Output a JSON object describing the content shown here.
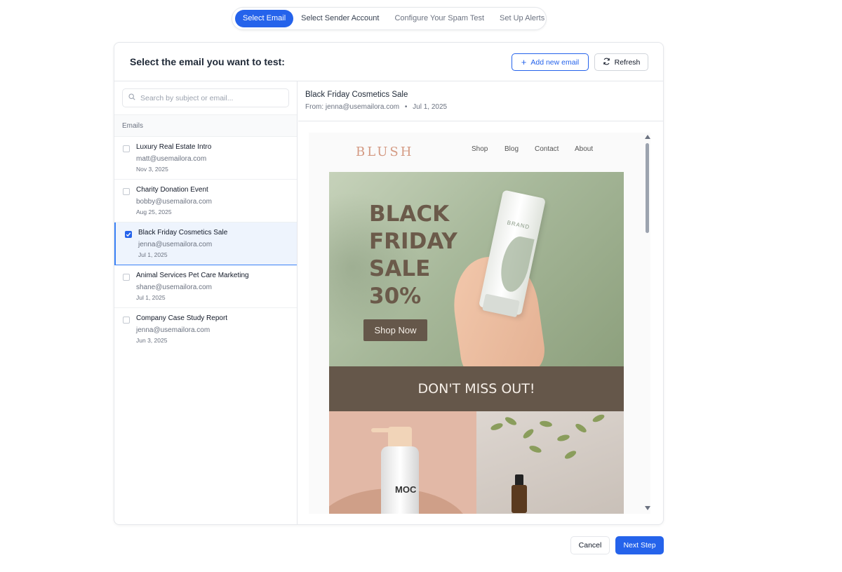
{
  "stepper": {
    "steps": [
      {
        "label": "Select Email",
        "active": true
      },
      {
        "label": "Select Sender Account",
        "active": false
      },
      {
        "label": "Configure Your Spam Test",
        "active": false
      },
      {
        "label": "Set Up Alerts",
        "active": false
      }
    ]
  },
  "header": {
    "title": "Select the email you want to test:",
    "add_label": "Add new email",
    "add_icon": "plus-icon",
    "refresh_label": "Refresh",
    "refresh_icon": "refresh-icon"
  },
  "search": {
    "placeholder": "Search by subject or email...",
    "icon": "search-icon"
  },
  "list": {
    "heading": "Emails",
    "items": [
      {
        "subject": "Luxury Real Estate Intro",
        "from": "matt@usemailora.com",
        "date": "Nov 3, 2025",
        "checked": false
      },
      {
        "subject": "Charity Donation Event",
        "from": "bobby@usemailora.com",
        "date": "Aug 25, 2025",
        "checked": false
      },
      {
        "subject": "Black Friday Cosmetics Sale",
        "from": "jenna@usemailora.com",
        "date": "Jul 1, 2025",
        "checked": true
      },
      {
        "subject": "Animal Services Pet Care Marketing",
        "from": "shane@usemailora.com",
        "date": "Jul 1, 2025",
        "checked": false
      },
      {
        "subject": "Company Case Study Report",
        "from": "jenna@usemailora.com",
        "date": "Jun 3, 2025",
        "checked": false
      }
    ]
  },
  "preview": {
    "subject": "Black Friday Cosmetics Sale",
    "from_line": "From: jenna@usemailora.com",
    "date": "Jul 1, 2025",
    "email": {
      "logo": "BLUSH",
      "nav": [
        "Shop",
        "Blog",
        "Contact",
        "About"
      ],
      "hero_lines": [
        "BLACK",
        "FRIDAY",
        "SALE",
        "30%"
      ],
      "shop_button": "Shop Now",
      "tube_label": "BRAND",
      "banner": "DON'T MISS OUT!",
      "bottle_text": "MOC"
    }
  },
  "footer": {
    "cancel_label": "Cancel",
    "next_label": "Next Step"
  },
  "colors": {
    "accent": "#2563eb",
    "banner": "#65574a",
    "hero_green": "#a7b89a"
  }
}
